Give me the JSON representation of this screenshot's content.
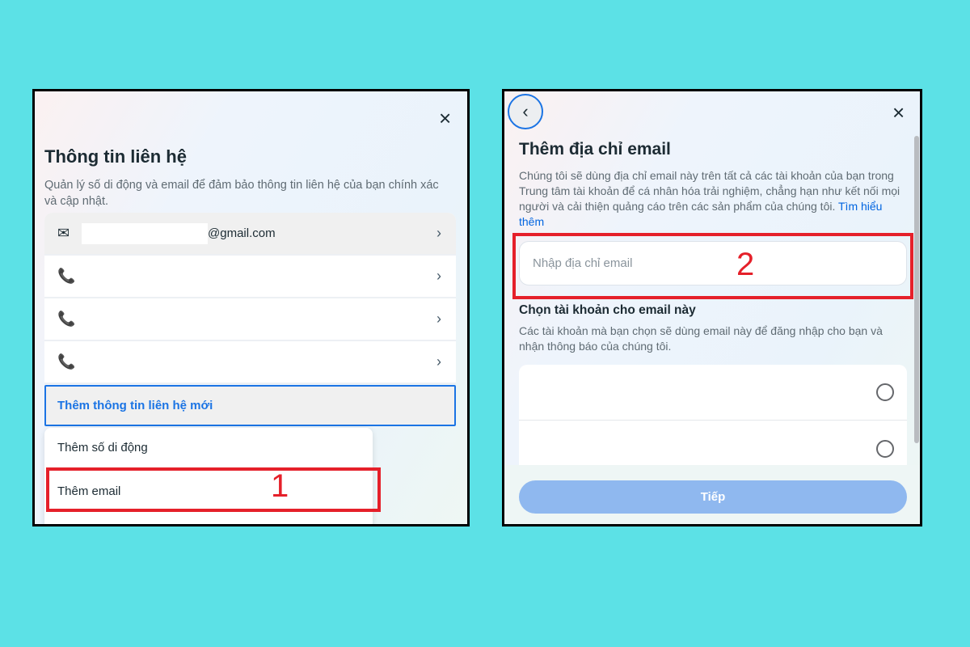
{
  "left_panel": {
    "title": "Thông tin liên hệ",
    "description": "Quản lý số di động và email để đảm bảo thông tin liên hệ của bạn chính xác và cập nhật.",
    "close_icon": "×",
    "contacts": [
      {
        "type": "email",
        "value": "@gmail.com"
      },
      {
        "type": "phone",
        "value": ""
      },
      {
        "type": "phone",
        "value": ""
      },
      {
        "type": "phone",
        "value": ""
      }
    ],
    "add_new_label": "Thêm thông tin liên hệ mới",
    "menu": [
      "Thêm số di động",
      "Thêm email"
    ],
    "step_label": "1"
  },
  "right_panel": {
    "title": "Thêm địa chỉ email",
    "description": "Chúng tôi sẽ dùng địa chỉ email này trên tất cả các tài khoản của bạn trong Trung tâm tài khoản để cá nhân hóa trải nghiệm, chẳng hạn như kết nối mọi người và cải thiện quảng cáo trên các sản phẩm của chúng tôi.",
    "learn_more": "Tìm hiểu thêm",
    "email_placeholder": "Nhập địa chỉ email",
    "step_label": "2",
    "accounts_heading": "Chọn tài khoản cho email này",
    "accounts_description": "Các tài khoản mà bạn chọn sẽ dùng email này để đăng nhập cho bạn và nhận thông báo của chúng tôi.",
    "accounts": [
      {
        "selected": false
      },
      {
        "selected": false
      }
    ],
    "next_button": "Tiếp",
    "colors": {
      "link": "#0064e0",
      "button_disabled": "#8fb8ef",
      "highlight": "#e5202a",
      "background": "#5ce1e6"
    }
  }
}
